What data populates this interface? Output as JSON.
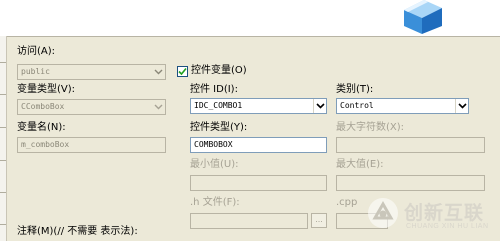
{
  "labels": {
    "access": "访问(A):",
    "var_type": "变量类型(V):",
    "var_name": "变量名(N):",
    "control_var": "控件变量(O)",
    "control_id": "控件 ID(I):",
    "category": "类别(T):",
    "control_type": "控件类型(Y):",
    "max_chars": "最大字符数(X):",
    "min_value": "最小值(U):",
    "max_value": "最大值(E):",
    "h_file": ".h 文件(F):",
    "cpp_file": ".cpp",
    "comment": "注释(M)(// 不需要 表示法):"
  },
  "values": {
    "access": "public",
    "var_type": "CComboBox",
    "var_name": "m_comboBox",
    "control_id": "IDC_COMBO1",
    "category": "Control",
    "control_type": "COMBOBOX"
  },
  "control_var_checked": true,
  "browse_label": "...",
  "watermark": {
    "name": "创新互联",
    "sub": "CHUANG XIN HU LIAN"
  },
  "colors": {
    "dialog_bg": "#ece9d8",
    "field_border": "#7f9db9",
    "disabled_text": "#a6a294",
    "logo_blue": "#3a8fd9"
  },
  "icons": {
    "logo": "wizard-cube-icon",
    "dropdown": "chevron-down-icon",
    "check": "checkmark-icon",
    "watermark": "brand-logo-icon"
  }
}
